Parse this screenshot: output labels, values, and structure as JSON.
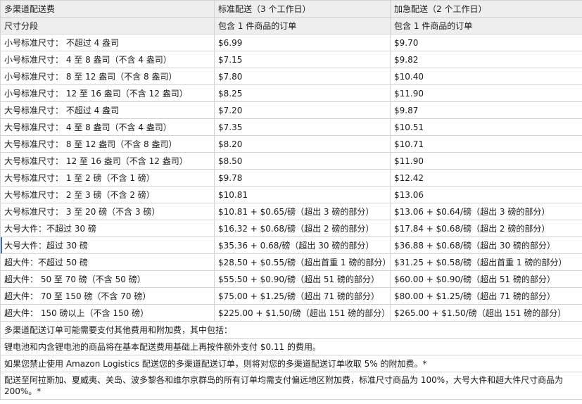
{
  "header": {
    "col1": "多渠道配送费",
    "col2": "标准配送（3 个工作日）",
    "col3": "加急配送（2 个工作日）"
  },
  "subheader": {
    "col1": "尺寸分段",
    "col2": "包含 1 件商品的订单",
    "col3": "包含 1 件商品的订单"
  },
  "rows": [
    {
      "tier": "小号标准尺寸：  不超过 4 盎司",
      "standard": "$6.99",
      "expedited": "$9.70"
    },
    {
      "tier": "小号标准尺寸：  4 至 8 盎司（不含 4 盎司）",
      "standard": "$7.15",
      "expedited": "$9.82"
    },
    {
      "tier": "小号标准尺寸：  8 至 12 盎司（不含 8 盎司）",
      "standard": "$7.80",
      "expedited": "$10.40"
    },
    {
      "tier": "小号标准尺寸：  12 至 16 盎司（不含 12 盎司）",
      "standard": "$8.25",
      "expedited": "$11.90"
    },
    {
      "tier": "大号标准尺寸：  不超过 4 盎司",
      "standard": "$7.20",
      "expedited": "$9.87"
    },
    {
      "tier": "大号标准尺寸：  4 至 8 盎司（不含 4 盎司）",
      "standard": "$7.35",
      "expedited": "$10.51"
    },
    {
      "tier": "大号标准尺寸：  8 至 12 盎司（不含 8 盎司）",
      "standard": "$8.20",
      "expedited": "$10.71"
    },
    {
      "tier": "大号标准尺寸：  12 至 16 盎司（不含 12 盎司）",
      "standard": "$8.50",
      "expedited": "$11.90"
    },
    {
      "tier": "大号标准尺寸：  1 至 2 磅（不含 1 磅）",
      "standard": "$9.78",
      "expedited": "$12.42"
    },
    {
      "tier": "大号标准尺寸：  2 至 3 磅（不含 2 磅）",
      "standard": "$10.81",
      "expedited": "$13.06"
    },
    {
      "tier": "大号标准尺寸：  3 至 20 磅（不含 3 磅）",
      "standard": "$10.81 + $0.65/磅（超出 3 磅的部分）",
      "expedited": "$13.06 + $0.64/磅（超出 3 磅的部分）"
    },
    {
      "tier": "大号大件：不超过 30 磅",
      "standard": "$16.32 + $0.68/磅（超出 2 磅的部分）",
      "expedited": "$17.84 + $0.68/磅（超出 2 磅的部分）"
    },
    {
      "tier": "大号大件：超过 30 磅",
      "standard": "$35.36 + 0.68/磅（超出 30 磅的部分）",
      "expedited": "$36.88 + $0.68/磅（超出 30 磅的部分）"
    },
    {
      "tier": "超大件：不超过 50 磅",
      "standard": "$28.50 + $0.55/磅（超出首重 1 磅的部分）",
      "expedited": "$31.25 + $0.58/磅（超出首重 1 磅的部分）"
    },
    {
      "tier": "超大件：  50 至 70 磅（不含 50 磅）",
      "standard": "$55.50 + $0.90/磅（超出 51 磅的部分）",
      "expedited": "$60.00 + $0.90/磅（超出 51 磅的部分）"
    },
    {
      "tier": "超大件：  70 至 150 磅（不含 70 磅）",
      "standard": "$75.00 + $1.25/磅（超出 71 磅的部分）",
      "expedited": "$80.00 + $1.25/磅（超出 71 磅的部分）"
    },
    {
      "tier": "超大件：  150 磅以上（不含 150 磅）",
      "standard": "$225.00 + $1.50/磅（超出 151 磅的部分）",
      "expedited": "$265.00 + $1.50/磅（超出 151 磅的部分）"
    }
  ],
  "notes": [
    "多渠道配送订单可能需要支付其他费用和附加费，其中包括：",
    "锂电池和内含锂电池的商品将在基本配送费用基础上再按件额外支付 $0.11 的费用。",
    "如果您禁止使用 Amazon Logistics 配送您的多渠道配送订单，则将对您的多渠道配送订单收取 5% 的附加费。*",
    "配送至阿拉斯加、夏威夷、关岛、波多黎各和维尔京群岛的所有订单均需支付偏远地区附加费，标准尺寸商品为 100%，大号大件和超大件尺寸商品为 200%。*"
  ]
}
